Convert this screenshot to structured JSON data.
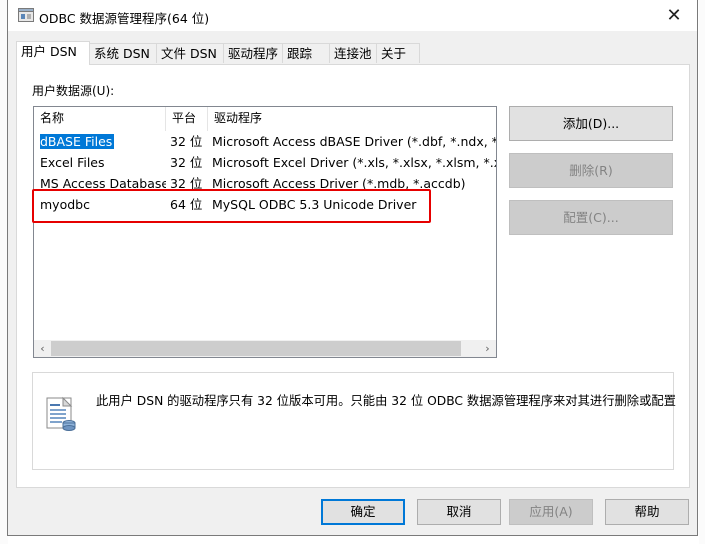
{
  "window": {
    "title": "ODBC 数据源管理程序(64 位)",
    "close_glyph": "✕"
  },
  "tabs": [
    {
      "label": "用户 DSN",
      "active": true
    },
    {
      "label": "系统 DSN",
      "active": false
    },
    {
      "label": "文件 DSN",
      "active": false
    },
    {
      "label": "驱动程序",
      "active": false
    },
    {
      "label": "跟踪",
      "active": false
    },
    {
      "label": "连接池",
      "active": false
    },
    {
      "label": "关于",
      "active": false
    }
  ],
  "user_dsn": {
    "section_label": "用户数据源(U):",
    "columns": [
      "名称",
      "平台",
      "驱动程序"
    ],
    "rows": [
      {
        "name": "dBASE Files",
        "platform": "32 位",
        "driver": "Microsoft Access dBASE Driver (*.dbf, *.ndx, *.mdx)"
      },
      {
        "name": "Excel Files",
        "platform": "32 位",
        "driver": "Microsoft Excel Driver (*.xls, *.xlsx, *.xlsm, *.xlsb)"
      },
      {
        "name": "MS Access Database",
        "platform": "32 位",
        "driver": "Microsoft Access Driver (*.mdb, *.accdb)"
      },
      {
        "name": "myodbc",
        "platform": "64 位",
        "driver": "MySQL ODBC 5.3 Unicode Driver"
      }
    ],
    "selected_row": 0,
    "buttons": {
      "add": "添加(D)...",
      "remove": "删除(R)",
      "configure": "配置(C)..."
    },
    "info_text": "此用户 DSN 的驱动程序只有 32 位版本可用。只能由 32 位 ODBC 数据源管理程序来对其进行删除或配置"
  },
  "dialog_buttons": {
    "ok": "确定",
    "cancel": "取消",
    "apply": "应用(A)",
    "help": "帮助"
  },
  "icons": {
    "app": "odbc-window-icon",
    "info": "data-source-info-icon",
    "scroll_left": "‹",
    "scroll_right": "›"
  },
  "colors": {
    "selection": "#0078d7",
    "annotation": "#e60000"
  }
}
